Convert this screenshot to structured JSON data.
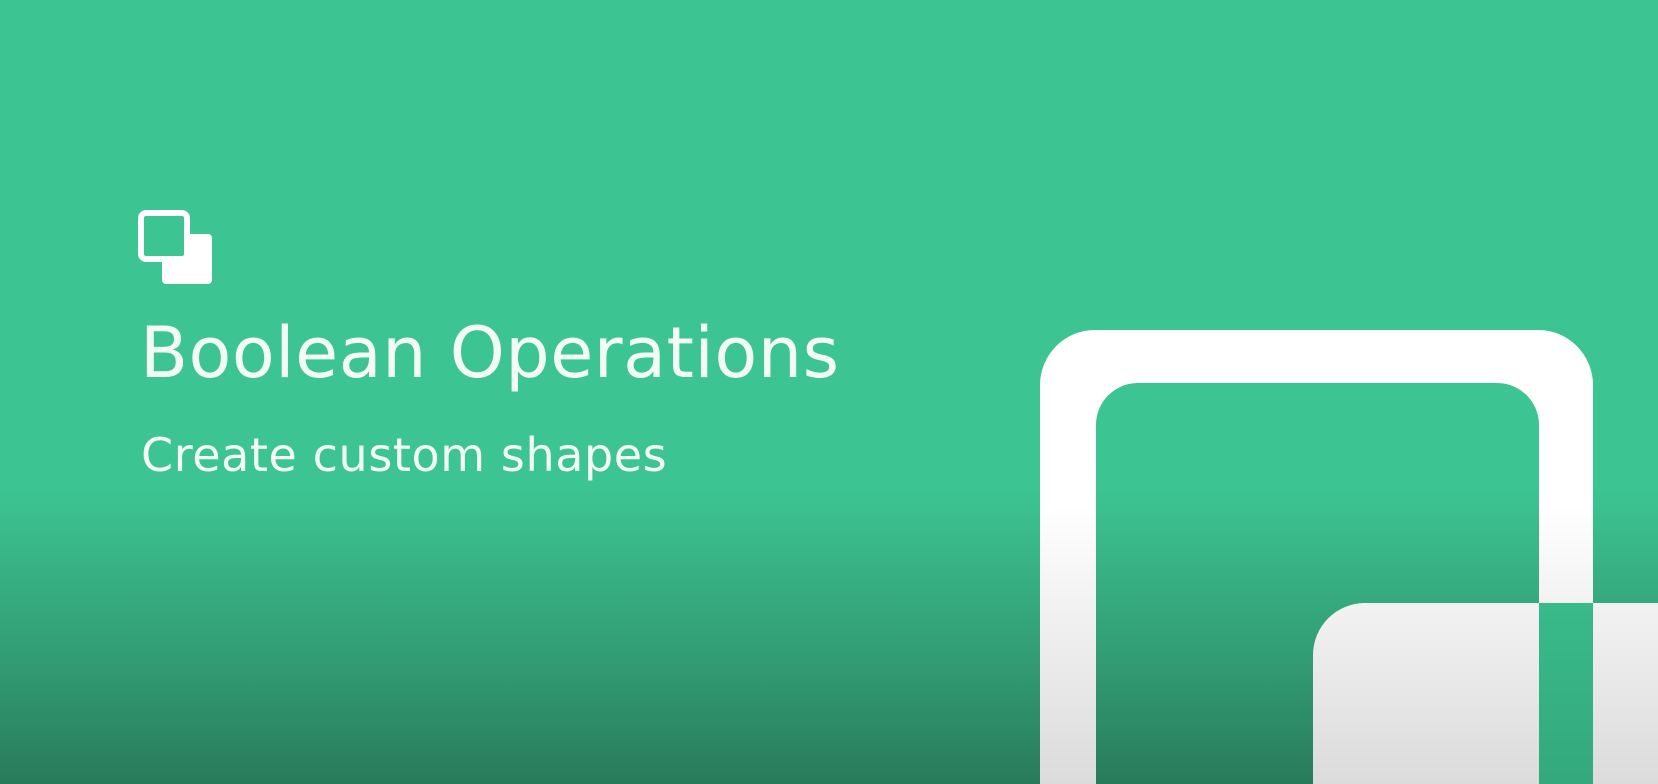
{
  "slide": {
    "title": "Boolean Operations",
    "subtitle": "Create custom shapes",
    "logo_icon": "boolean-union-icon",
    "decoration": "overlapping-rounded-squares-graphic"
  },
  "colors": {
    "background": "#3cc492",
    "foreground": "#ffffff"
  }
}
